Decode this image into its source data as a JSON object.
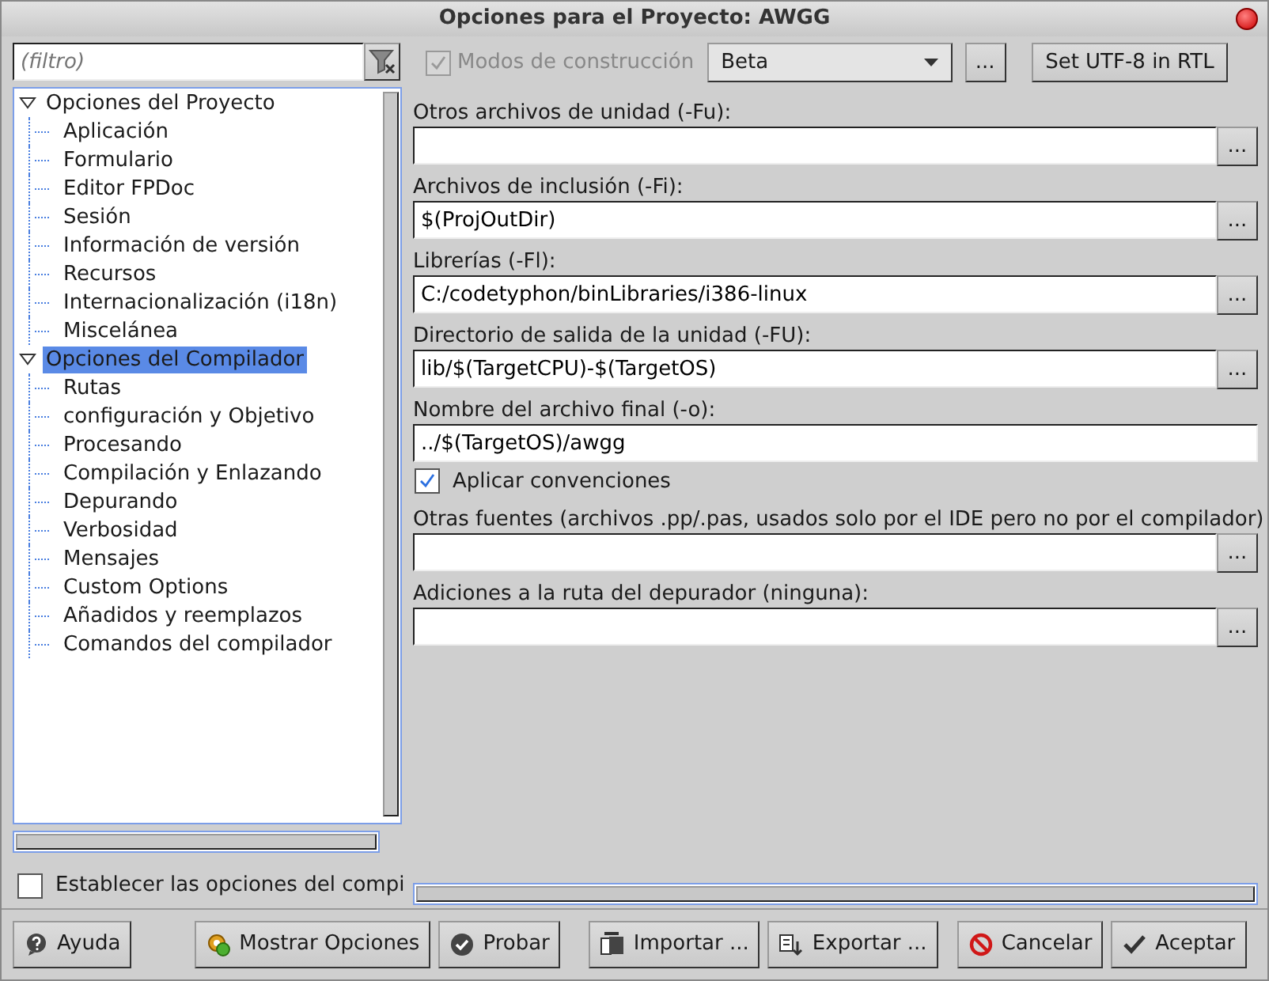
{
  "window": {
    "title": "Opciones para el Proyecto: AWGG"
  },
  "filter": {
    "placeholder": "(filtro)"
  },
  "build_modes": {
    "label": "Modos de construcción",
    "checked": true,
    "disabled": true,
    "mode": "Beta",
    "more_button": "...",
    "utf8_button": "Set UTF-8 in RTL"
  },
  "tree": [
    {
      "label": "Opciones del Proyecto",
      "expanded": true,
      "selected": false,
      "children": [
        {
          "label": "Aplicación",
          "selected": false
        },
        {
          "label": "Formulario",
          "selected": false
        },
        {
          "label": "Editor FPDoc",
          "selected": false
        },
        {
          "label": "Sesión",
          "selected": false
        },
        {
          "label": "Información de versión",
          "selected": false
        },
        {
          "label": "Recursos",
          "selected": false
        },
        {
          "label": "Internacionalización (i18n)",
          "selected": false
        },
        {
          "label": "Miscelánea",
          "selected": false
        }
      ]
    },
    {
      "label": "Opciones del Compilador",
      "expanded": true,
      "selected": true,
      "children": [
        {
          "label": "Rutas",
          "selected": false
        },
        {
          "label": "configuración y Objetivo",
          "selected": false
        },
        {
          "label": "Procesando",
          "selected": false
        },
        {
          "label": "Compilación y Enlazando",
          "selected": false
        },
        {
          "label": "Depurando",
          "selected": false
        },
        {
          "label": "Verbosidad",
          "selected": false
        },
        {
          "label": "Mensajes",
          "selected": false
        },
        {
          "label": "Custom Options",
          "selected": false
        },
        {
          "label": "Añadidos y reemplazos",
          "selected": false
        },
        {
          "label": "Comandos del compilador",
          "selected": false
        }
      ]
    }
  ],
  "set_compiler_options": {
    "label": "Establecer las opciones del compi",
    "checked": false
  },
  "paths": [
    {
      "kind": "path",
      "label": "Otros archivos de unidad (-Fu):",
      "button": "..."
    },
    {
      "kind": "path",
      "label": "Archivos de inclusión (-Fi):",
      "value": "$(ProjOutDir)",
      "button": "..."
    },
    {
      "kind": "path",
      "label": "Librerías (-Fl):",
      "value": "C:/codetyphon/binLibraries/i386-linux",
      "button": "..."
    },
    {
      "kind": "path",
      "label": "Directorio de salida de la unidad (-FU):",
      "value": "lib/$(TargetCPU)-$(TargetOS)",
      "button": "..."
    },
    {
      "kind": "path",
      "label": "Nombre del archivo final (-o):",
      "value": "../$(TargetOS)/awgg"
    },
    {
      "kind": "check",
      "label": "Aplicar convenciones",
      "checked": true
    },
    {
      "kind": "path",
      "label": "Otras fuentes (archivos .pp/.pas, usados solo por el IDE pero no por el compilador)",
      "button": "..."
    },
    {
      "kind": "path",
      "label": "Adiciones a la ruta del depurador (ninguna):",
      "button": "..."
    }
  ],
  "buttons": [
    {
      "label": "Ayuda"
    },
    {
      "label": "Mostrar Opciones"
    },
    {
      "label": "Probar"
    },
    {
      "label": "Importar ..."
    },
    {
      "label": "Exportar ..."
    },
    {
      "label": "Cancelar"
    },
    {
      "label": "Aceptar"
    }
  ]
}
